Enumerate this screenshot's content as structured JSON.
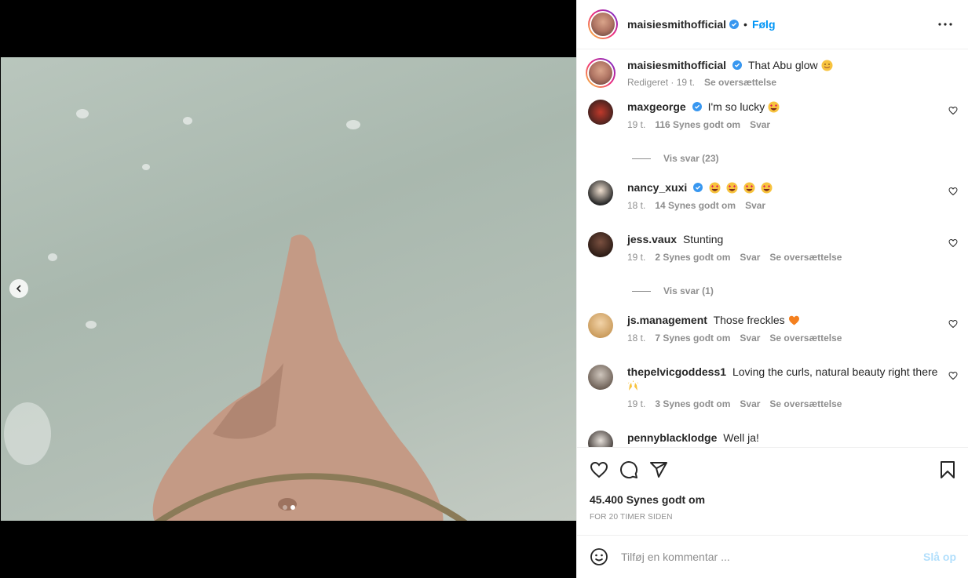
{
  "header": {
    "username": "maisiesmithofficial",
    "separator": "•",
    "follow_label": "Følg"
  },
  "caption": {
    "username": "maisiesmithofficial",
    "text": "That Abu glow",
    "meta_edited": "Redigeret · 19 t.",
    "meta_translate": "Se oversættelse"
  },
  "comments": [
    {
      "username": "maxgeorge",
      "verified": true,
      "text": "I'm so lucky",
      "time": "19 t.",
      "likes": "116 Synes godt om",
      "reply": "Svar",
      "translate": ""
    },
    {
      "username": "nancy_xuxi",
      "verified": true,
      "text": "",
      "time": "18 t.",
      "likes": "14 Synes godt om",
      "reply": "Svar",
      "translate": ""
    },
    {
      "username": "jess.vaux",
      "verified": false,
      "text": "Stunting",
      "time": "19 t.",
      "likes": "2 Synes godt om",
      "reply": "Svar",
      "translate": "Se oversættelse"
    },
    {
      "username": "js.management",
      "verified": false,
      "text": "Those freckles",
      "time": "18 t.",
      "likes": "7 Synes godt om",
      "reply": "Svar",
      "translate": "Se oversættelse"
    },
    {
      "username": "thepelvicgoddess1",
      "verified": false,
      "text": "Loving the curls, natural beauty right there",
      "time": "19 t.",
      "likes": "3 Synes godt om",
      "reply": "Svar",
      "translate": "Se oversættelse"
    },
    {
      "username": "pennyblacklodge",
      "verified": false,
      "text": "Well ja!"
    }
  ],
  "view_replies": [
    "Vis svar (23)",
    "Vis svar (1)"
  ],
  "likes_count": "45.400 Synes godt om",
  "time_ago": "FOR 20 TIMER SIDEN",
  "add_comment": {
    "placeholder": "Tilføj en kommentar ...",
    "post_label": "Slå op"
  },
  "carousel": {
    "count": 2,
    "active": 2
  },
  "colors": {
    "accent": "#0095f6",
    "verified": "#3897f0",
    "muted": "#8e8e8e"
  },
  "icons": [
    "verified-icon",
    "more-options-icon",
    "heart-icon",
    "comment-icon",
    "share-icon",
    "bookmark-icon",
    "emoji-icon",
    "chevron-left-icon"
  ]
}
